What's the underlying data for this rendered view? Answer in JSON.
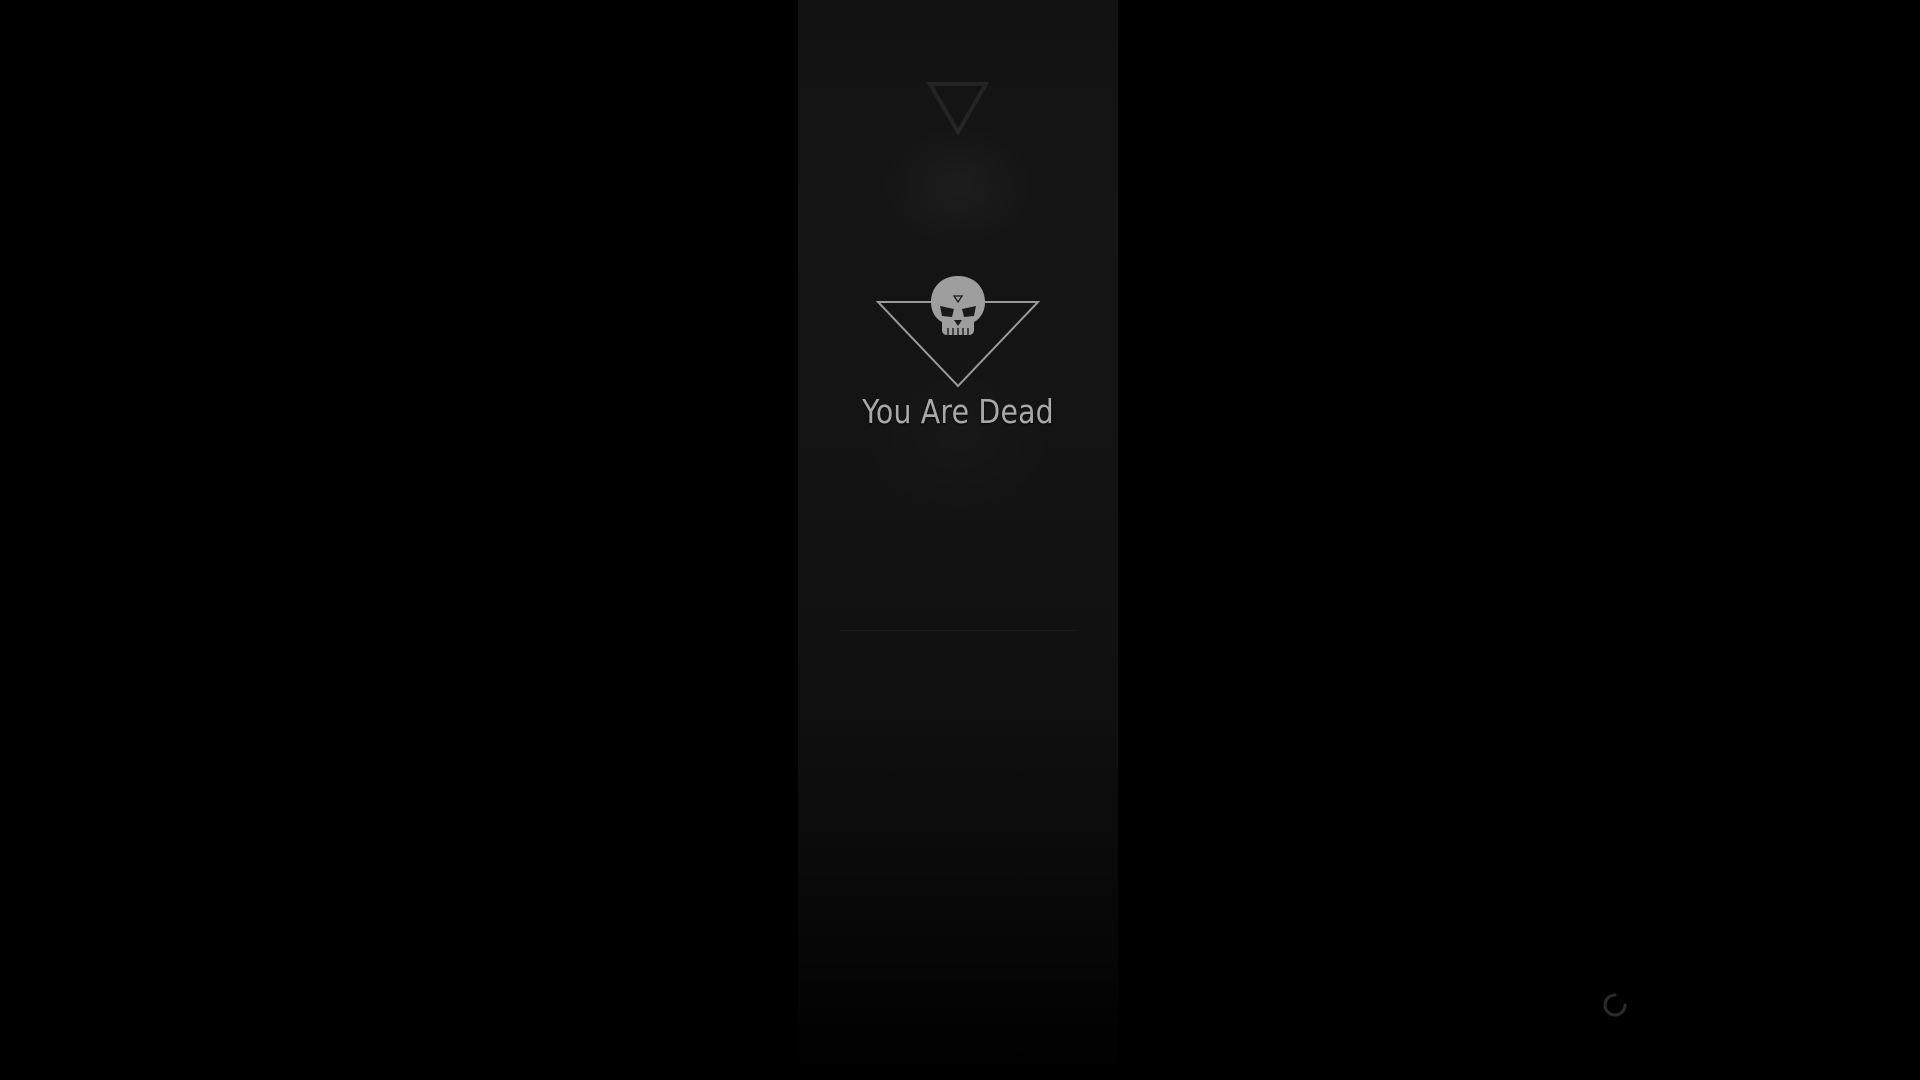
{
  "death_screen": {
    "title": "You Are Dead",
    "emblem_icon": "skull-triangle-icon"
  },
  "loading": {
    "icon": "loading-spinner-icon"
  },
  "colors": {
    "background": "#000000",
    "panel": "#141414",
    "text": "#a8a8a8"
  }
}
